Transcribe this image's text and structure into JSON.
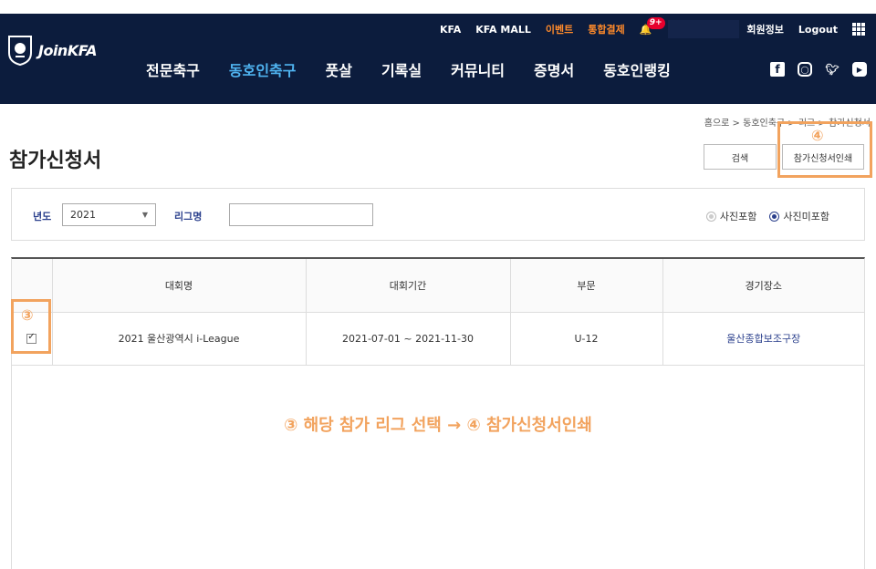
{
  "header": {
    "logo_text": "JoinKFA",
    "util": {
      "kfa": "KFA",
      "mall": "KFA MALL",
      "event": "이벤트",
      "payment": "통합결제",
      "badge": "9+",
      "member": "회원정보",
      "logout": "Logout"
    },
    "nav": [
      "전문축구",
      "동호인축구",
      "풋살",
      "기록실",
      "커뮤니티",
      "증명서",
      "동호인랭킹"
    ],
    "nav_active_index": 1,
    "sns": [
      "facebook-icon",
      "instagram-icon",
      "twitter-icon",
      "youtube-icon"
    ]
  },
  "breadcrumb": "홈으로 > 동호인축구 > 리그 > 참가신청서",
  "page_title": "참가신청서",
  "buttons": {
    "search": "검색",
    "print": "참가신청서인쇄"
  },
  "annotations": {
    "print_num": "④",
    "check_num": "③",
    "caption": "③ 해당 참가 리그 선택 → ④ 참가신청서인쇄"
  },
  "filter": {
    "year_label": "년도",
    "year_value": "2021",
    "league_label": "리그명",
    "league_value": "",
    "radio_photo": "사진포함",
    "radio_no_photo": "사진미포함",
    "radio_selected": "사진미포함"
  },
  "table": {
    "headers": [
      "",
      "대회명",
      "대회기간",
      "부문",
      "경기장소"
    ],
    "rows": [
      {
        "checked": true,
        "name": "2021 울산광역시 i-League",
        "period": "2021-07-01 ~ 2021-11-30",
        "division": "U-12",
        "venue": "울산종합보조구장"
      }
    ]
  },
  "colors": {
    "header_bg": "#0c1c3d",
    "accent": "#4fb3f0",
    "highlight": "#f2a35e",
    "link": "#2a3f8c"
  }
}
